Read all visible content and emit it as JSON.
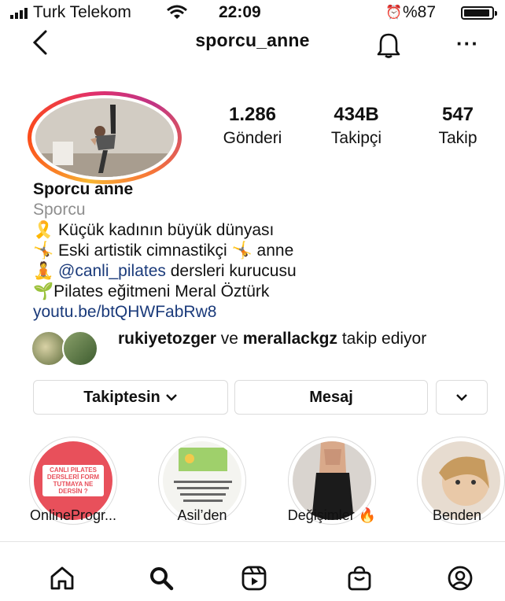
{
  "status_bar": {
    "carrier": "Turk Telekom",
    "time": "22:09",
    "battery": "%87"
  },
  "header": {
    "username": "sporcu_anne",
    "icons": [
      "back-icon",
      "bell-icon",
      "more-icon"
    ]
  },
  "stats": [
    {
      "value": "1.286",
      "label": "Gönderi"
    },
    {
      "value": "434B",
      "label": "Takipçi"
    },
    {
      "value": "547",
      "label": "Takip"
    }
  ],
  "bio": {
    "name": "Sporcu anne",
    "category": "Sporcu",
    "line1": "Küçük kadının büyük dünyası",
    "line2a": "Eski artistik cimnastikçi",
    "line2b": "anne",
    "line3_mention": "@canli_pilates",
    "line3_rest": " dersleri kurucusu",
    "line4": "Pilates eğitmeni Meral Öztürk",
    "link": "youtu.be/btQHWFabRw8"
  },
  "followed_by": {
    "user1": "rukiyetozger",
    "connector": " ve ",
    "user2": "merallackgz",
    "rest": " takip ediyor"
  },
  "buttons": {
    "follow": "Takiptesin",
    "message": "Mesaj"
  },
  "highlights": [
    {
      "label": "OnlineProgr...",
      "text": "CANLI PILATES DERSLERİ FORM TUTMAYA NE DERSİN ?"
    },
    {
      "label": "Asil’den"
    },
    {
      "label": "Değişimler 🔥"
    },
    {
      "label": "Benden"
    }
  ],
  "colors": {
    "link": "#1a3a7a",
    "muted": "#8e8e8e",
    "border": "#dbdbdb",
    "highlight1": "#e8505b"
  }
}
